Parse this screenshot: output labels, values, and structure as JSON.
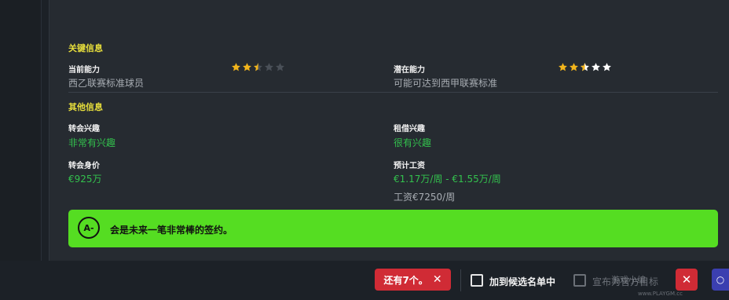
{
  "key_info": {
    "heading": "关键信息",
    "current_ability": {
      "label": "当前能力",
      "value": "西乙联赛标准球员",
      "stars": 2.5,
      "max": 5
    },
    "potential_ability": {
      "label": "潜在能力",
      "value": "可能可达到西甲联赛标准",
      "stars": 2.5,
      "max": 5
    }
  },
  "other_info": {
    "heading": "其他信息",
    "transfer_interest": {
      "label": "转会兴趣",
      "value": "非常有兴趣"
    },
    "loan_interest": {
      "label": "租借兴趣",
      "value": "很有兴趣"
    },
    "transfer_value": {
      "label": "转会身价",
      "value": "€925万"
    },
    "expected_wage": {
      "label": "预计工资",
      "value": "€1.17万/周 - €1.55万/周",
      "current": "工资€7250/周"
    }
  },
  "callout": {
    "icon_text": "A-",
    "text": "会是未来一笔非常棒的签约。"
  },
  "bottom": {
    "remaining": "还有7个。",
    "add_shortlist": "加到候选名单中",
    "announce_target": "宣布为官方目标"
  },
  "watermark": {
    "main": "游戏小编",
    "sub": "www.PLAYGM.cc"
  },
  "colors": {
    "heading": "#e8df3c",
    "green_value": "#33c14d",
    "callout_bg": "#55dd22",
    "pill_red": "#d02b35",
    "star_gold": "#f2b51c",
    "star_white": "#ffffff",
    "star_empty": "#4a5058"
  },
  "icons": [
    "star-icon",
    "close-icon",
    "checkbox-icon",
    "grade-badge-icon"
  ]
}
